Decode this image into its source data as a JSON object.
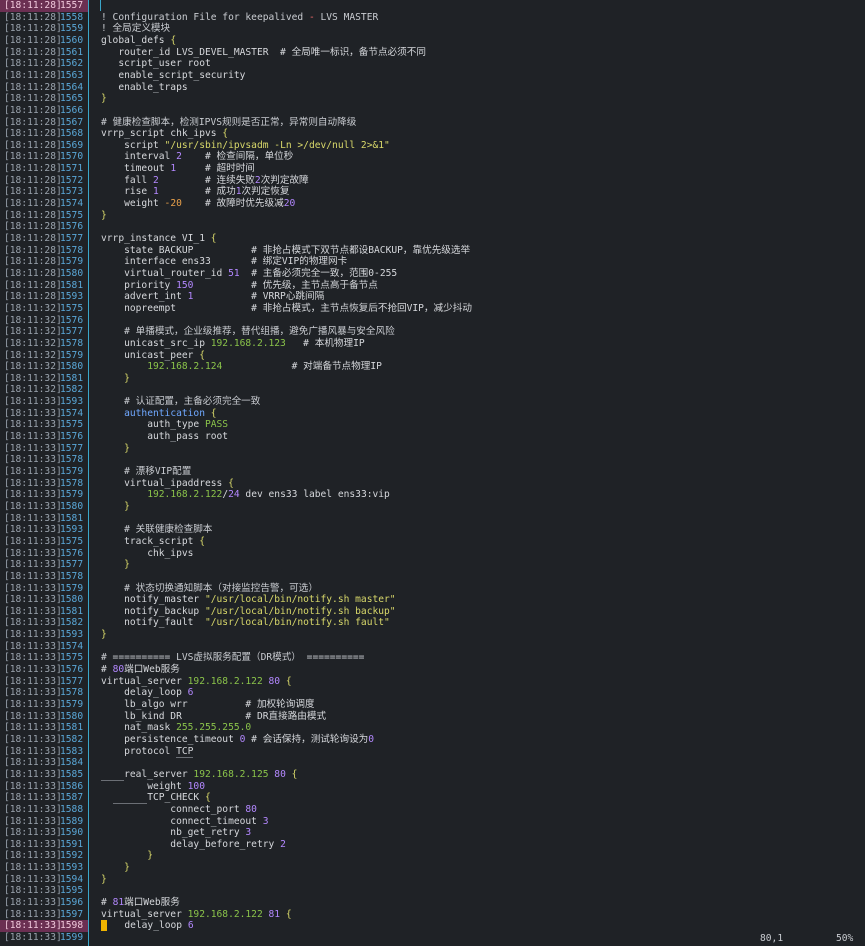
{
  "status": {
    "position": "80,1",
    "percent": "50%"
  },
  "lines": [
    {
      "ts": "[18:11:28]",
      "ln": "1557",
      "hl": true,
      "code": []
    },
    {
      "ts": "[18:11:28]",
      "ln": "1558",
      "code": [
        [
          "! Configuration File for keepalived ",
          "cmt"
        ],
        [
          "-",
          "red"
        ],
        [
          " LVS MASTER",
          "cmt"
        ]
      ]
    },
    {
      "ts": "[18:11:28]",
      "ln": "1559",
      "code": [
        [
          "! 全局定义模块",
          "cmt"
        ]
      ]
    },
    {
      "ts": "[18:11:28]",
      "ln": "1560",
      "code": [
        [
          "global_defs ",
          ""
        ],
        [
          "{",
          "brc"
        ]
      ]
    },
    {
      "ts": "[18:11:28]",
      "ln": "1561",
      "code": [
        [
          "   router_id LVS_DEVEL_MASTER  # 全局唯一标识，备节点必须不同",
          ""
        ]
      ]
    },
    {
      "ts": "[18:11:28]",
      "ln": "1562",
      "code": [
        [
          "   script_user root",
          ""
        ]
      ]
    },
    {
      "ts": "[18:11:28]",
      "ln": "1563",
      "code": [
        [
          "   enable_script_security",
          ""
        ]
      ]
    },
    {
      "ts": "[18:11:28]",
      "ln": "1564",
      "code": [
        [
          "   enable_traps",
          ""
        ]
      ]
    },
    {
      "ts": "[18:11:28]",
      "ln": "1565",
      "code": [
        [
          "}",
          "brc"
        ]
      ]
    },
    {
      "ts": "[18:11:28]",
      "ln": "1566",
      "code": []
    },
    {
      "ts": "[18:11:28]",
      "ln": "1567",
      "code": [
        [
          "# 健康检查脚本，检测IPVS规则是否正常，异常则自动降级",
          "cmt"
        ]
      ]
    },
    {
      "ts": "[18:11:28]",
      "ln": "1568",
      "code": [
        [
          "vrrp_script chk_ipvs ",
          ""
        ],
        [
          "{",
          "brc"
        ]
      ]
    },
    {
      "ts": "[18:11:28]",
      "ln": "1569",
      "code": [
        [
          "    script ",
          ""
        ],
        [
          "\"/usr/sbin/ipvsadm -Ln >/dev/null 2>&1\"",
          "str"
        ]
      ]
    },
    {
      "ts": "[18:11:28]",
      "ln": "1570",
      "code": [
        [
          "    interval ",
          ""
        ],
        [
          "2",
          "num"
        ],
        [
          "    # 检查间隔，单位秒",
          ""
        ]
      ]
    },
    {
      "ts": "[18:11:28]",
      "ln": "1571",
      "code": [
        [
          "    timeout ",
          ""
        ],
        [
          "1",
          "num"
        ],
        [
          "     # 超时时间",
          ""
        ]
      ]
    },
    {
      "ts": "[18:11:28]",
      "ln": "1572",
      "code": [
        [
          "    fall ",
          ""
        ],
        [
          "2",
          "num"
        ],
        [
          "        # 连续失败",
          ""
        ],
        [
          "2",
          "num"
        ],
        [
          "次判定故障",
          ""
        ]
      ]
    },
    {
      "ts": "[18:11:28]",
      "ln": "1573",
      "code": [
        [
          "    rise ",
          ""
        ],
        [
          "1",
          "num"
        ],
        [
          "        # 成功",
          ""
        ],
        [
          "1",
          "num"
        ],
        [
          "次判定恢复",
          ""
        ]
      ]
    },
    {
      "ts": "[18:11:28]",
      "ln": "1574",
      "code": [
        [
          "    weight ",
          ""
        ],
        [
          "-20",
          "neg"
        ],
        [
          "    # 故障时优先级减",
          ""
        ],
        [
          "20",
          "num"
        ]
      ]
    },
    {
      "ts": "[18:11:28]",
      "ln": "1575",
      "code": [
        [
          "}",
          "brc"
        ]
      ]
    },
    {
      "ts": "[18:11:28]",
      "ln": "1576",
      "code": []
    },
    {
      "ts": "[18:11:28]",
      "ln": "1577",
      "code": [
        [
          "vrrp_instance VI_1 ",
          ""
        ],
        [
          "{",
          "brc"
        ]
      ]
    },
    {
      "ts": "[18:11:28]",
      "ln": "1578",
      "code": [
        [
          "    state BACKUP          # 非抢占模式下双节点都设BACKUP，靠优先级选举",
          ""
        ]
      ]
    },
    {
      "ts": "[18:11:28]",
      "ln": "1579",
      "code": [
        [
          "    interface ens33       # 绑定VIP的物理网卡",
          ""
        ]
      ]
    },
    {
      "ts": "[18:11:28]",
      "ln": "1580",
      "code": [
        [
          "    virtual_router_id ",
          ""
        ],
        [
          "51",
          "num"
        ],
        [
          "  # 主备必须完全一致，范围0-255",
          ""
        ]
      ]
    },
    {
      "ts": "[18:11:28]",
      "ln": "1581",
      "code": [
        [
          "    priority ",
          ""
        ],
        [
          "150",
          "num"
        ],
        [
          "          # 优先级，主节点高于备节点",
          ""
        ]
      ]
    },
    {
      "ts": "[18:11:28]",
      "ln": "1593",
      "code": [
        [
          "    advert_int ",
          ""
        ],
        [
          "1",
          "num"
        ],
        [
          "          # VRRP心跳间隔",
          ""
        ]
      ]
    },
    {
      "ts": "[18:11:32]",
      "ln": "1575",
      "code": [
        [
          "    nopreempt             # 非抢占模式，主节点恢复后不抢回VIP，减少抖动",
          ""
        ]
      ]
    },
    {
      "ts": "[18:11:32]",
      "ln": "1576",
      "code": []
    },
    {
      "ts": "[18:11:32]",
      "ln": "1577",
      "code": [
        [
          "    # 单播模式，企业级推荐，替代组播，避免广播风暴与安全风险",
          "cmt"
        ]
      ]
    },
    {
      "ts": "[18:11:32]",
      "ln": "1578",
      "code": [
        [
          "    unicast_src_ip ",
          ""
        ],
        [
          "192.168.2.123",
          "grn"
        ],
        [
          "   # 本机物理IP",
          ""
        ]
      ]
    },
    {
      "ts": "[18:11:32]",
      "ln": "1579",
      "code": [
        [
          "    unicast_peer ",
          ""
        ],
        [
          "{",
          "brc"
        ]
      ]
    },
    {
      "ts": "[18:11:32]",
      "ln": "1580",
      "code": [
        [
          "        ",
          ""
        ],
        [
          "192.168.2.124",
          "grn"
        ],
        [
          "            # 对端备节点物理IP",
          ""
        ]
      ]
    },
    {
      "ts": "[18:11:32]",
      "ln": "1581",
      "code": [
        [
          "    ",
          ""
        ],
        [
          "}",
          "brc"
        ]
      ]
    },
    {
      "ts": "[18:11:32]",
      "ln": "1582",
      "code": []
    },
    {
      "ts": "[18:11:33]",
      "ln": "1593",
      "code": [
        [
          "    # 认证配置，主备必须完全一致",
          "cmt"
        ]
      ]
    },
    {
      "ts": "[18:11:33]",
      "ln": "1574",
      "code": [
        [
          "    ",
          ""
        ],
        [
          "authentication",
          "blu"
        ],
        [
          " ",
          ""
        ],
        [
          "{",
          "brc"
        ]
      ]
    },
    {
      "ts": "[18:11:33]",
      "ln": "1575",
      "code": [
        [
          "        auth_type ",
          ""
        ],
        [
          "PASS",
          "grn"
        ]
      ]
    },
    {
      "ts": "[18:11:33]",
      "ln": "1576",
      "code": [
        [
          "        auth_pass root",
          ""
        ]
      ]
    },
    {
      "ts": "[18:11:33]",
      "ln": "1577",
      "code": [
        [
          "    ",
          ""
        ],
        [
          "}",
          "brc"
        ]
      ]
    },
    {
      "ts": "[18:11:33]",
      "ln": "1578",
      "code": []
    },
    {
      "ts": "[18:11:33]",
      "ln": "1579",
      "code": [
        [
          "    # 漂移VIP配置",
          "cmt"
        ]
      ]
    },
    {
      "ts": "[18:11:33]",
      "ln": "1578",
      "code": [
        [
          "    virtual_ipaddress ",
          ""
        ],
        [
          "{",
          "brc"
        ]
      ]
    },
    {
      "ts": "[18:11:33]",
      "ln": "1579",
      "code": [
        [
          "        ",
          ""
        ],
        [
          "192.168.2.122",
          "grn"
        ],
        [
          "/",
          ""
        ],
        [
          "24",
          "num"
        ],
        [
          " dev ens33 label ens33:vip",
          ""
        ]
      ]
    },
    {
      "ts": "[18:11:33]",
      "ln": "1580",
      "code": [
        [
          "    ",
          ""
        ],
        [
          "}",
          "brc"
        ]
      ]
    },
    {
      "ts": "[18:11:33]",
      "ln": "1581",
      "code": []
    },
    {
      "ts": "[18:11:33]",
      "ln": "1593",
      "code": [
        [
          "    # 关联健康检查脚本",
          "cmt"
        ]
      ]
    },
    {
      "ts": "[18:11:33]",
      "ln": "1575",
      "code": [
        [
          "    track_script ",
          ""
        ],
        [
          "{",
          "brc"
        ]
      ]
    },
    {
      "ts": "[18:11:33]",
      "ln": "1576",
      "code": [
        [
          "        chk_ipvs",
          ""
        ]
      ]
    },
    {
      "ts": "[18:11:33]",
      "ln": "1577",
      "code": [
        [
          "    ",
          ""
        ],
        [
          "}",
          "brc"
        ]
      ]
    },
    {
      "ts": "[18:11:33]",
      "ln": "1578",
      "code": []
    },
    {
      "ts": "[18:11:33]",
      "ln": "1579",
      "code": [
        [
          "    # 状态切换通知脚本（对接监控告警，可选）",
          "cmt"
        ]
      ]
    },
    {
      "ts": "[18:11:33]",
      "ln": "1580",
      "code": [
        [
          "    notify_master ",
          ""
        ],
        [
          "\"/usr/local/bin/notify.sh master\"",
          "str"
        ]
      ]
    },
    {
      "ts": "[18:11:33]",
      "ln": "1581",
      "code": [
        [
          "    notify_backup ",
          ""
        ],
        [
          "\"/usr/local/bin/notify.sh backup\"",
          "str"
        ]
      ]
    },
    {
      "ts": "[18:11:33]",
      "ln": "1582",
      "code": [
        [
          "    notify_fault  ",
          ""
        ],
        [
          "\"/usr/local/bin/notify.sh fault\"",
          "str"
        ]
      ]
    },
    {
      "ts": "[18:11:33]",
      "ln": "1593",
      "code": [
        [
          "}",
          "brc"
        ]
      ]
    },
    {
      "ts": "[18:11:33]",
      "ln": "1574",
      "code": []
    },
    {
      "ts": "[18:11:33]",
      "ln": "1575",
      "code": [
        [
          "# ========== LVS虚拟服务配置（DR模式） ==========",
          "cmt"
        ]
      ]
    },
    {
      "ts": "[18:11:33]",
      "ln": "1576",
      "code": [
        [
          "# ",
          ""
        ],
        [
          "80",
          "num"
        ],
        [
          "端口Web服务",
          ""
        ]
      ]
    },
    {
      "ts": "[18:11:33]",
      "ln": "1577",
      "code": [
        [
          "virtual_server ",
          ""
        ],
        [
          "192.168.2.122",
          "grn"
        ],
        [
          " ",
          ""
        ],
        [
          "80",
          "num"
        ],
        [
          " ",
          ""
        ],
        [
          "{",
          "brc"
        ]
      ]
    },
    {
      "ts": "[18:11:33]",
      "ln": "1578",
      "code": [
        [
          "    delay_loop ",
          ""
        ],
        [
          "6",
          "num"
        ]
      ]
    },
    {
      "ts": "[18:11:33]",
      "ln": "1579",
      "code": [
        [
          "    lb_algo wrr          # 加权轮询调度",
          ""
        ]
      ]
    },
    {
      "ts": "[18:11:33]",
      "ln": "1580",
      "code": [
        [
          "    lb_kind DR           # DR直接路由模式",
          ""
        ]
      ]
    },
    {
      "ts": "[18:11:33]",
      "ln": "1581",
      "code": [
        [
          "    nat_mask ",
          ""
        ],
        [
          "255.255.255.0",
          "grn"
        ]
      ]
    },
    {
      "ts": "[18:11:33]",
      "ln": "1582",
      "code": [
        [
          "    persistence_timeout ",
          ""
        ],
        [
          "0",
          "num"
        ],
        [
          " # 会话保持，测试轮询设为",
          ""
        ],
        [
          "0",
          "num"
        ]
      ]
    },
    {
      "ts": "[18:11:33]",
      "ln": "1583",
      "code": [
        [
          "    protocol ",
          ""
        ],
        [
          "TCP",
          "guide"
        ]
      ]
    },
    {
      "ts": "[18:11:33]",
      "ln": "1584",
      "code": []
    },
    {
      "ts": "[18:11:33]",
      "ln": "1585",
      "code": [
        [
          "    ",
          "guide"
        ],
        [
          "real_server ",
          ""
        ],
        [
          "192.168.2.125",
          "grn"
        ],
        [
          " ",
          ""
        ],
        [
          "80",
          "num"
        ],
        [
          " ",
          ""
        ],
        [
          "{",
          "brc"
        ]
      ]
    },
    {
      "ts": "[18:11:33]",
      "ln": "1586",
      "code": [
        [
          "        weight ",
          ""
        ],
        [
          "100",
          "num"
        ]
      ]
    },
    {
      "ts": "[18:11:33]",
      "ln": "1587",
      "code": [
        [
          "  ",
          ""
        ],
        [
          "      ",
          "guide"
        ],
        [
          "TCP_CHECK ",
          ""
        ],
        [
          "{",
          "brc"
        ]
      ]
    },
    {
      "ts": "[18:11:33]",
      "ln": "1588",
      "code": [
        [
          "            connect_port ",
          ""
        ],
        [
          "80",
          "num"
        ]
      ]
    },
    {
      "ts": "[18:11:33]",
      "ln": "1589",
      "code": [
        [
          "            connect_timeout ",
          ""
        ],
        [
          "3",
          "num"
        ]
      ]
    },
    {
      "ts": "[18:11:33]",
      "ln": "1590",
      "code": [
        [
          "            nb_get_retry ",
          ""
        ],
        [
          "3",
          "num"
        ]
      ]
    },
    {
      "ts": "[18:11:33]",
      "ln": "1591",
      "code": [
        [
          "            delay_before_retry ",
          ""
        ],
        [
          "2",
          "num"
        ]
      ]
    },
    {
      "ts": "[18:11:33]",
      "ln": "1592",
      "code": [
        [
          "        ",
          ""
        ],
        [
          "}",
          "brc"
        ]
      ]
    },
    {
      "ts": "[18:11:33]",
      "ln": "1593",
      "code": [
        [
          "    ",
          ""
        ],
        [
          "}",
          "brc"
        ]
      ]
    },
    {
      "ts": "[18:11:33]",
      "ln": "1594",
      "code": [
        [
          "}",
          "brc"
        ]
      ]
    },
    {
      "ts": "[18:11:33]",
      "ln": "1595",
      "code": []
    },
    {
      "ts": "[18:11:33]",
      "ln": "1596",
      "code": [
        [
          "# ",
          ""
        ],
        [
          "81",
          "num"
        ],
        [
          "端口Web服务",
          ""
        ]
      ]
    },
    {
      "ts": "[18:11:33]",
      "ln": "1597",
      "code": [
        [
          "virtual_server ",
          ""
        ],
        [
          "192.168.2.122",
          "grn"
        ],
        [
          " ",
          ""
        ],
        [
          "81",
          "num"
        ],
        [
          " ",
          ""
        ],
        [
          "{",
          "brc"
        ]
      ]
    },
    {
      "ts": "[18:11:33]",
      "ln": "1598",
      "hl": true,
      "cursor": true,
      "code": [
        [
          "   delay_loop ",
          ""
        ],
        [
          "6",
          "num"
        ]
      ]
    },
    {
      "ts": "[18:11:33]",
      "ln": "1599",
      "code": []
    }
  ]
}
